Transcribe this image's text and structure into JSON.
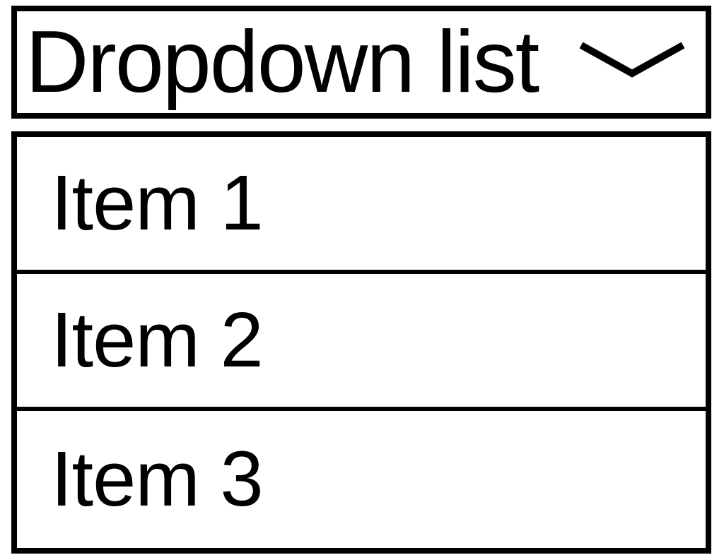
{
  "dropdown": {
    "label": "Dropdown list",
    "items": [
      {
        "label": "Item 1"
      },
      {
        "label": "Item 2"
      },
      {
        "label": "Item 3"
      }
    ]
  }
}
